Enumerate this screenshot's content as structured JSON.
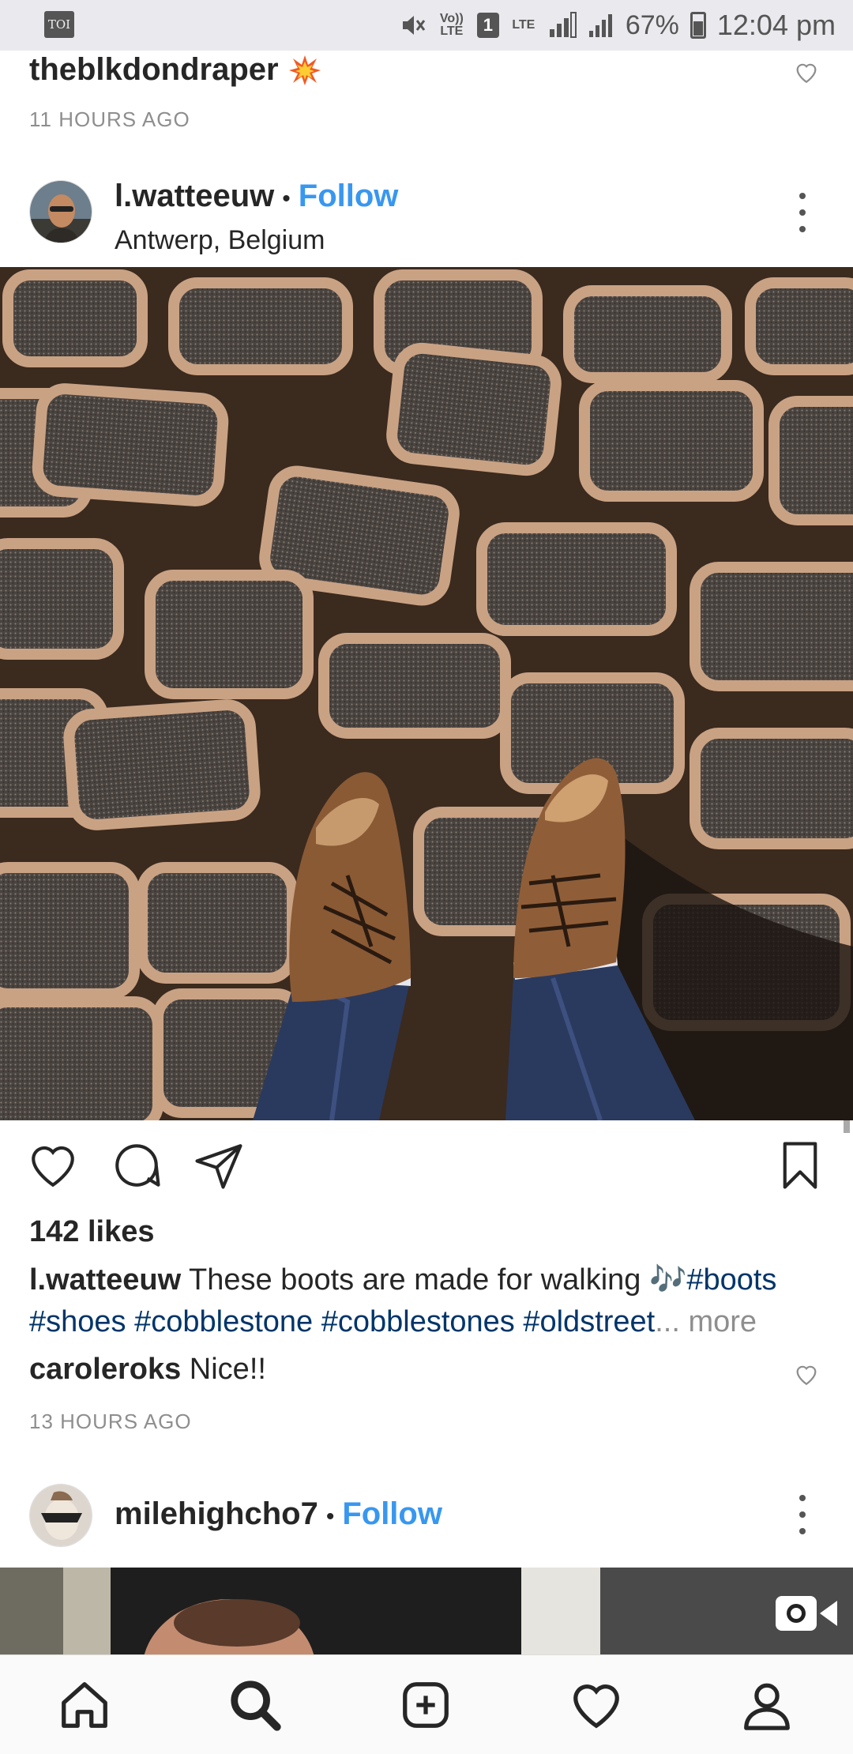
{
  "status_bar": {
    "left_icon_label": "TOI",
    "volte_label": "Vo)) LTE",
    "sim_label": "1",
    "lte_label": "LTE",
    "battery_percent": "67%",
    "time": "12:04 pm"
  },
  "previous_post": {
    "username": "theblkdondraper",
    "emoji": "collision-icon",
    "timestamp": "11 HOURS AGO"
  },
  "post": {
    "username": "l.watteeuw",
    "separator": "•",
    "follow_label": "Follow",
    "location": "Antwerp, Belgium",
    "likes": "142 likes",
    "caption_user": "l.watteeuw",
    "caption_text": "These boots are made for walking",
    "caption_emoji": "🎶",
    "caption_tags_line1": "#boots",
    "caption_tags_line2": "#shoes #cobblestone #cobblestones #oldstreet",
    "ellipsis": "...",
    "more_label": "more",
    "comment_user": "caroleroks",
    "comment_text": "Nice!!",
    "timestamp": "13 HOURS AGO"
  },
  "next_post": {
    "username": "milehighcho7",
    "separator": "•",
    "follow_label": "Follow"
  },
  "bottom_nav": [
    "home-icon",
    "search-icon",
    "add-post-icon",
    "activity-heart-icon",
    "profile-icon"
  ],
  "colors": {
    "link_blue": "#3897f0",
    "hashtag_navy": "#003569",
    "muted_gray": "#8e8e8e",
    "text": "#262626"
  }
}
